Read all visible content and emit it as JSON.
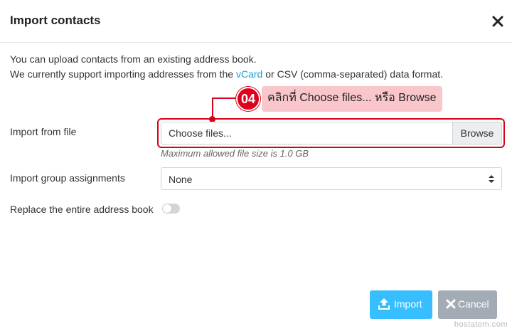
{
  "dialog": {
    "title": "Import contacts",
    "close_icon": "close-icon"
  },
  "intro": {
    "line1": "You can upload contacts from an existing address book.",
    "line2_before": "We currently support importing addresses from the ",
    "line2_link": "vCard",
    "line2_after": " or CSV (comma-separated) data format."
  },
  "form": {
    "file": {
      "label": "Import from file",
      "placeholder": "Choose files...",
      "browse_label": "Browse",
      "hint": "Maximum allowed file size is 1.0 GB"
    },
    "group": {
      "label": "Import group assignments",
      "value": "None"
    },
    "replace": {
      "label": "Replace the entire address book",
      "checked": false
    }
  },
  "callout": {
    "number": "04",
    "text": "คลิกที่ Choose files... หรือ Browse",
    "color": "#d9001b",
    "bg": "#f9c6cb"
  },
  "buttons": {
    "import_label": "Import",
    "import_icon": "upload-icon",
    "import_color": "#37beff",
    "cancel_label": "Cancel",
    "cancel_icon": "x-icon",
    "cancel_color": "#a3acb4"
  },
  "watermark": "hostatom.com"
}
